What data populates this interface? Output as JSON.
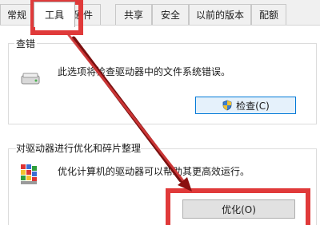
{
  "tabs": [
    {
      "label": "常规"
    },
    {
      "label": "工具"
    },
    {
      "label": "硬件"
    },
    {
      "label": "共享"
    },
    {
      "label": "安全"
    },
    {
      "label": "以前的版本"
    },
    {
      "label": "配额"
    }
  ],
  "error_check": {
    "title": "查错",
    "description": "此选项将检查驱动器中的文件系统错误。",
    "button_label": "检查(C)"
  },
  "optimize": {
    "title": "对驱动器进行优化和碎片整理",
    "description": "优化计算机的驱动器可以帮助其更高效运行。",
    "button_label": "优化(O)"
  },
  "annotation_color": "#e03a3a"
}
